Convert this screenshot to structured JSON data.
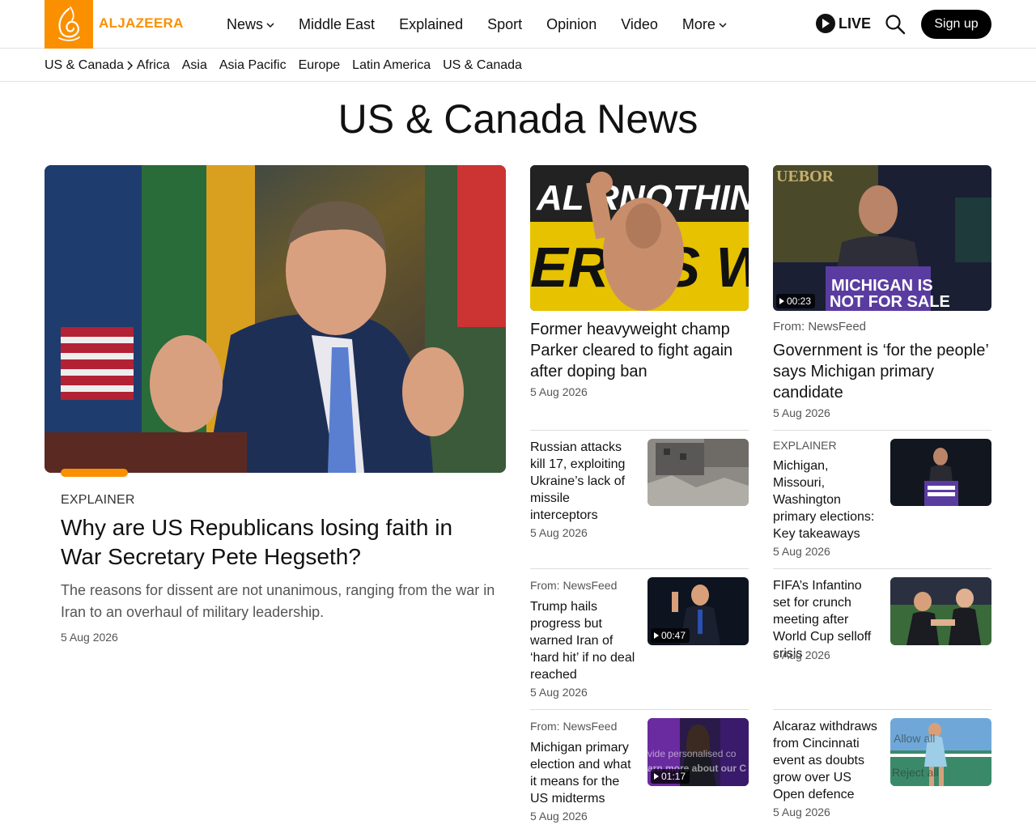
{
  "header": {
    "logo_text": "ALJAZEERA",
    "nav": [
      {
        "label": "News",
        "dropdown": true
      },
      {
        "label": "Middle East",
        "dropdown": false
      },
      {
        "label": "Explained",
        "dropdown": false
      },
      {
        "label": "Sport",
        "dropdown": false
      },
      {
        "label": "Opinion",
        "dropdown": false
      },
      {
        "label": "Video",
        "dropdown": false
      },
      {
        "label": "More",
        "dropdown": true
      }
    ],
    "live_label": "LIVE",
    "signup_label": "Sign up"
  },
  "subnav": {
    "current": "US & Canada",
    "items": [
      "Africa",
      "Asia",
      "Asia Pacific",
      "Europe",
      "Latin America",
      "US & Canada"
    ]
  },
  "page_title": "US & Canada News",
  "hero": {
    "kicker": "EXPLAINER",
    "title": "Why are US Republicans losing faith in War Secretary Pete Hegseth?",
    "description": "The reasons for dissent are not unanimous, ranging from the war in Iran to an overhaul of military leadership.",
    "date": "5 Aug 2026"
  },
  "top_cards": [
    {
      "from": "",
      "title": "Former heavyweight champ Parker cleared to fight again after doping ban",
      "date": "5 Aug 2026",
      "duration": ""
    },
    {
      "from": "From: NewsFeed",
      "title": "Government is ‘for the people’ says Michigan primary candidate",
      "date": "5 Aug 2026",
      "duration": "00:23"
    }
  ],
  "small_cards": [
    {
      "from": "",
      "title": "Russian attacks kill 17, exploiting Ukraine’s lack of missile interceptors",
      "date": "5 Aug 2026",
      "duration": ""
    },
    {
      "from": "EXPLAINER",
      "title": "Michigan, Missouri, Washington primary elections: Key takeaways",
      "date": "5 Aug 2026",
      "duration": ""
    },
    {
      "from": "From: NewsFeed",
      "title": "Trump hails progress but warned Iran of ‘hard hit’ if no deal reached",
      "date": "5 Aug 2026",
      "duration": "00:47"
    },
    {
      "from": "",
      "title": "FIFA’s Infantino set for crunch meeting after World Cup selloff crisis",
      "date": "5 Aug 2026",
      "duration": ""
    },
    {
      "from": "From: NewsFeed",
      "title": "Michigan primary election and what it means for the US midterms",
      "date": "5 Aug 2026",
      "duration": "01:17"
    },
    {
      "from": "",
      "title": "Alcaraz withdraws from Cincinnati event as doubts grow over US Open defence",
      "date": "5 Aug 2026",
      "duration": ""
    }
  ],
  "cookie_banner": {
    "allow_label": "Allow all",
    "reject_label": "Reject all",
    "text_line1": "vide personalised co",
    "text_line2": "arn more about our C"
  },
  "colors": {
    "brand": "#fa9000",
    "text": "#111111",
    "muted": "#555555"
  }
}
